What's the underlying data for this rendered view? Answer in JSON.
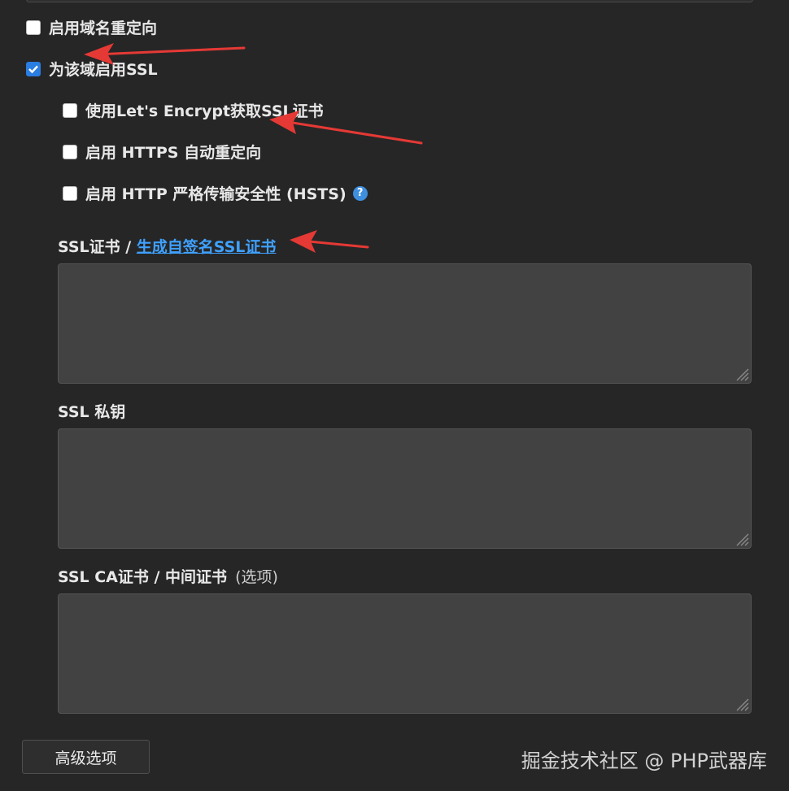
{
  "options": {
    "redirect_domain": {
      "label": "启用域名重定向",
      "checked": false
    },
    "enable_ssl": {
      "label": "为该域启用SSL",
      "checked": true
    },
    "lets_encrypt": {
      "label": "使用Let's Encrypt获取SSL证书",
      "checked": false
    },
    "https_redirect": {
      "label": "启用 HTTPS 自动重定向",
      "checked": false
    },
    "hsts": {
      "label": "启用 HTTP 严格传输安全性 (HSTS)",
      "checked": false,
      "help_icon": "?"
    }
  },
  "fields": {
    "ssl_cert": {
      "label": "SSL证书 / ",
      "link": "生成自签名SSL证书",
      "value": ""
    },
    "ssl_key": {
      "label": "SSL 私钥",
      "value": ""
    },
    "ssl_ca": {
      "label": "SSL CA证书 / 中间证书",
      "optional": "(选项)",
      "value": ""
    }
  },
  "buttons": {
    "advanced": "高级选项"
  },
  "watermark": "掘金技术社区 @ PHP武器库",
  "colors": {
    "background": "#262626",
    "link": "#3fa1ff",
    "checkbox_checked": "#2a7de1",
    "annotation_arrow": "#e53935"
  }
}
